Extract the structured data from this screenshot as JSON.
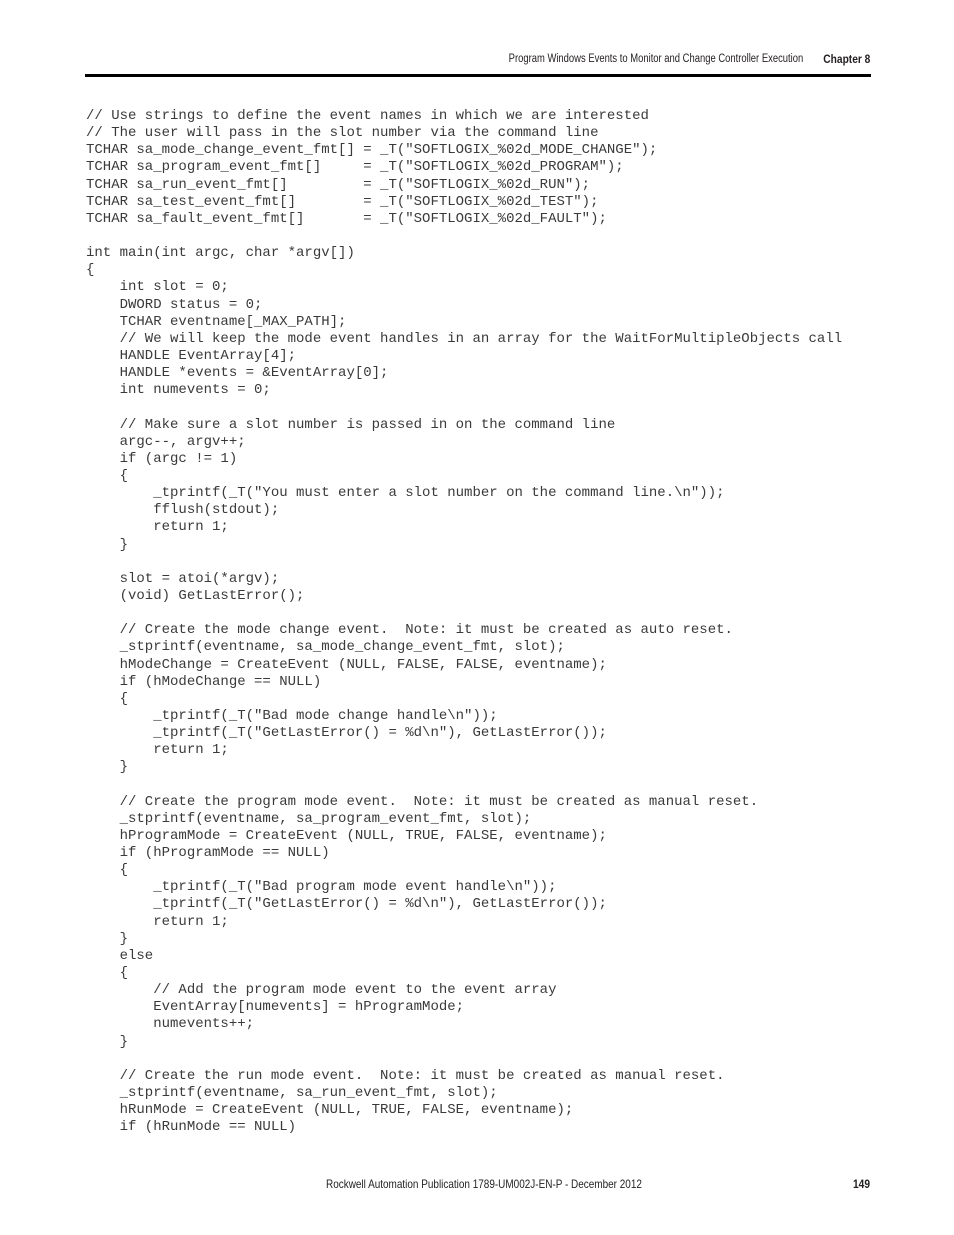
{
  "header": {
    "section_title": "Program Windows Events to Monitor and Change Controller Execution",
    "chapter": "Chapter 8"
  },
  "code": {
    "language": "C",
    "lines": [
      "// Use strings to define the event names in which we are interested",
      "// The user will pass in the slot number via the command line",
      "TCHAR sa_mode_change_event_fmt[] = _T(\"SOFTLOGIX_%02d_MODE_CHANGE\");",
      "TCHAR sa_program_event_fmt[]     = _T(\"SOFTLOGIX_%02d_PROGRAM\");",
      "TCHAR sa_run_event_fmt[]         = _T(\"SOFTLOGIX_%02d_RUN\");",
      "TCHAR sa_test_event_fmt[]        = _T(\"SOFTLOGIX_%02d_TEST\");",
      "TCHAR sa_fault_event_fmt[]       = _T(\"SOFTLOGIX_%02d_FAULT\");",
      "",
      "int main(int argc, char *argv[])",
      "{",
      "    int slot = 0;",
      "    DWORD status = 0;",
      "    TCHAR eventname[_MAX_PATH];",
      "    // We will keep the mode event handles in an array for the WaitForMultipleObjects call",
      "    HANDLE EventArray[4];",
      "    HANDLE *events = &EventArray[0];",
      "    int numevents = 0;",
      "",
      "    // Make sure a slot number is passed in on the command line",
      "    argc--, argv++;",
      "    if (argc != 1)",
      "    {",
      "        _tprintf(_T(\"You must enter a slot number on the command line.\\n\"));",
      "        fflush(stdout);",
      "        return 1;",
      "    }",
      "",
      "    slot = atoi(*argv);",
      "    (void) GetLastError();",
      "",
      "    // Create the mode change event.  Note: it must be created as auto reset.",
      "    _stprintf(eventname, sa_mode_change_event_fmt, slot);",
      "    hModeChange = CreateEvent (NULL, FALSE, FALSE, eventname);",
      "    if (hModeChange == NULL)",
      "    {",
      "        _tprintf(_T(\"Bad mode change handle\\n\"));",
      "        _tprintf(_T(\"GetLastError() = %d\\n\"), GetLastError());",
      "        return 1;",
      "    }",
      "",
      "    // Create the program mode event.  Note: it must be created as manual reset.",
      "    _stprintf(eventname, sa_program_event_fmt, slot);",
      "    hProgramMode = CreateEvent (NULL, TRUE, FALSE, eventname);",
      "    if (hProgramMode == NULL)",
      "    {",
      "        _tprintf(_T(\"Bad program mode event handle\\n\"));",
      "        _tprintf(_T(\"GetLastError() = %d\\n\"), GetLastError());",
      "        return 1;",
      "    }",
      "    else",
      "    {",
      "        // Add the program mode event to the event array",
      "        EventArray[numevents] = hProgramMode;",
      "        numevents++;",
      "    }",
      "",
      "    // Create the run mode event.  Note: it must be created as manual reset.",
      "    _stprintf(eventname, sa_run_event_fmt, slot);",
      "    hRunMode = CreateEvent (NULL, TRUE, FALSE, eventname);",
      "    if (hRunMode == NULL)"
    ]
  },
  "footer": {
    "publication": "Rockwell Automation Publication 1789-UM002J-EN-P - December 2012",
    "page_number": "149"
  }
}
